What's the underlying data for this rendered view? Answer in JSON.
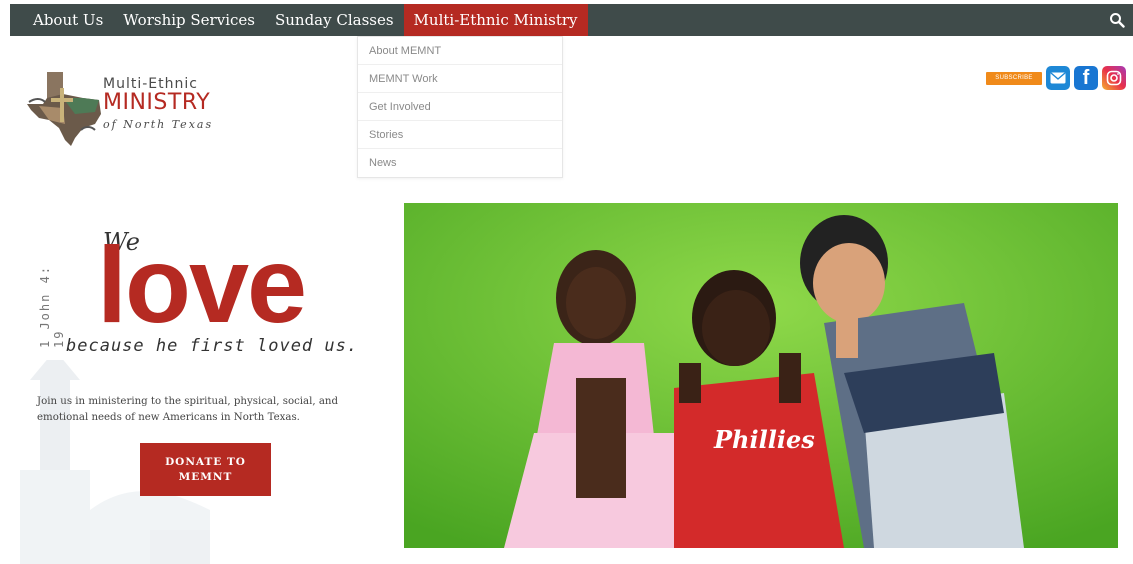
{
  "nav": {
    "items": [
      {
        "label": "About Us"
      },
      {
        "label": "Worship Services"
      },
      {
        "label": "Sunday Classes"
      },
      {
        "label": "Multi-Ethnic Ministry"
      }
    ],
    "active_color": "#b52a22",
    "bar_color": "#3f4b4a"
  },
  "dropdown": {
    "items": [
      "About MEMNT",
      "MEMNT Work",
      "Get Involved",
      "Stories",
      "News"
    ]
  },
  "logo": {
    "line1": "Multi-Ethnic",
    "line2": "MINISTRY",
    "line3": "of North Texas"
  },
  "social": {
    "subscribe": "SUBSCRIBE",
    "icons": [
      "mail-icon",
      "facebook-icon",
      "instagram-icon"
    ]
  },
  "hero": {
    "verse_ref": "1 John 4: 19",
    "we": "We",
    "love": "love",
    "because": "because he first loved us.",
    "intro": "Join us in ministering to the spiritual, physical, social, and emotional needs of new Americans in North Texas.",
    "donate": "DONATE TO MEMNT"
  },
  "colors": {
    "accent": "#b52a22",
    "facebook": "#1976d2",
    "subscribe": "#f08a1a"
  }
}
